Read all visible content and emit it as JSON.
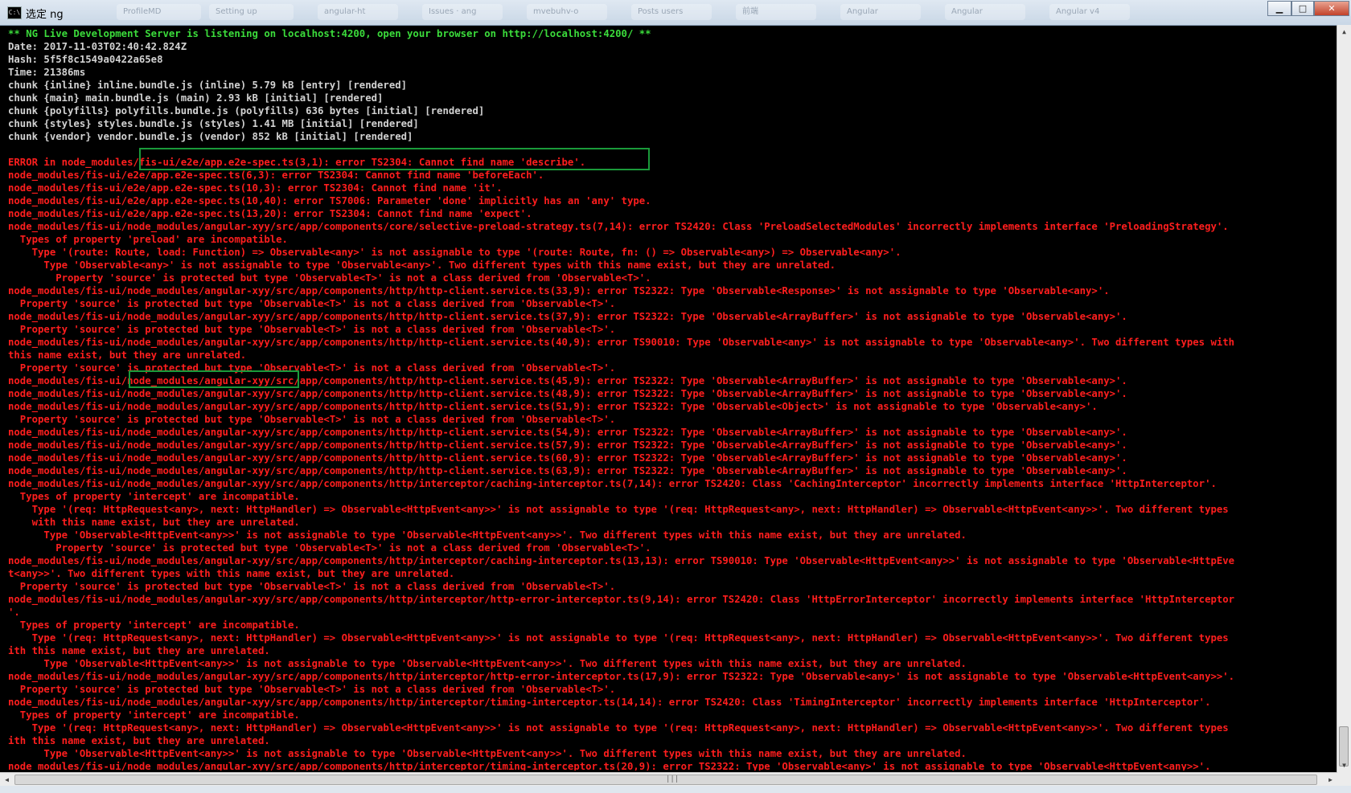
{
  "window": {
    "title": "选定 ng",
    "icon": "console-icon",
    "taskbar_ghost_tabs": [
      "ProfileMD",
      "Setting up",
      "angular-ht",
      "Issues · ang",
      "mvebuhv-o",
      "Posts users",
      "前端",
      "Angular",
      "Angular",
      "Angular v4"
    ],
    "controls": {
      "minimize": "▁",
      "maximize": "□",
      "close": "✕"
    }
  },
  "console": {
    "lines": [
      {
        "color": "green",
        "text": "** NG Live Development Server is listening on localhost:4200, open your browser on http://localhost:4200/ **"
      },
      {
        "color": "white",
        "text": "Date: 2017-11-03T02:40:42.824Z"
      },
      {
        "color": "white",
        "text": "Hash: 5f5f8c1549a0422a65e8"
      },
      {
        "color": "white",
        "text": "Time: 21386ms"
      },
      {
        "color": "white",
        "text": "chunk {inline} inline.bundle.js (inline) 5.79 kB [entry] [rendered]"
      },
      {
        "color": "white",
        "text": "chunk {main} main.bundle.js (main) 2.93 kB [initial] [rendered]"
      },
      {
        "color": "white",
        "text": "chunk {polyfills} polyfills.bundle.js (polyfills) 636 bytes [initial] [rendered]"
      },
      {
        "color": "white",
        "text": "chunk {styles} styles.bundle.js (styles) 1.41 MB [initial] [rendered]"
      },
      {
        "color": "white",
        "text": "chunk {vendor} vendor.bundle.js (vendor) 852 kB [initial] [rendered]"
      },
      {
        "color": "white",
        "text": ""
      },
      {
        "color": "red",
        "text": "ERROR in node_modules/fis-ui/e2e/app.e2e-spec.ts(3,1): error TS2304: Cannot find name 'describe'."
      },
      {
        "color": "red",
        "text": "node_modules/fis-ui/e2e/app.e2e-spec.ts(6,3): error TS2304: Cannot find name 'beforeEach'."
      },
      {
        "color": "red",
        "text": "node_modules/fis-ui/e2e/app.e2e-spec.ts(10,3): error TS2304: Cannot find name 'it'."
      },
      {
        "color": "red",
        "text": "node_modules/fis-ui/e2e/app.e2e-spec.ts(10,40): error TS7006: Parameter 'done' implicitly has an 'any' type."
      },
      {
        "color": "red",
        "text": "node_modules/fis-ui/e2e/app.e2e-spec.ts(13,20): error TS2304: Cannot find name 'expect'."
      },
      {
        "color": "red",
        "text": "node_modules/fis-ui/node_modules/angular-xyy/src/app/components/core/selective-preload-strategy.ts(7,14): error TS2420: Class 'PreloadSelectedModules' incorrectly implements interface 'PreloadingStrategy'."
      },
      {
        "color": "red",
        "text": "  Types of property 'preload' are incompatible."
      },
      {
        "color": "red",
        "text": "    Type '(route: Route, load: Function) => Observable<any>' is not assignable to type '(route: Route, fn: () => Observable<any>) => Observable<any>'."
      },
      {
        "color": "red",
        "text": "      Type 'Observable<any>' is not assignable to type 'Observable<any>'. Two different types with this name exist, but they are unrelated."
      },
      {
        "color": "red",
        "text": "        Property 'source' is protected but type 'Observable<T>' is not a class derived from 'Observable<T>'."
      },
      {
        "color": "red",
        "text": "node_modules/fis-ui/node_modules/angular-xyy/src/app/components/http/http-client.service.ts(33,9): error TS2322: Type 'Observable<Response>' is not assignable to type 'Observable<any>'."
      },
      {
        "color": "red",
        "text": "  Property 'source' is protected but type 'Observable<T>' is not a class derived from 'Observable<T>'."
      },
      {
        "color": "red",
        "text": "node_modules/fis-ui/node_modules/angular-xyy/src/app/components/http/http-client.service.ts(37,9): error TS2322: Type 'Observable<ArrayBuffer>' is not assignable to type 'Observable<any>'."
      },
      {
        "color": "red",
        "text": "  Property 'source' is protected but type 'Observable<T>' is not a class derived from 'Observable<T>'."
      },
      {
        "color": "red",
        "text": "node_modules/fis-ui/node_modules/angular-xyy/src/app/components/http/http-client.service.ts(40,9): error TS90010: Type 'Observable<any>' is not assignable to type 'Observable<any>'. Two different types with"
      },
      {
        "color": "red",
        "text": "this name exist, but they are unrelated."
      },
      {
        "color": "red",
        "text": "  Property 'source' is protected but type 'Observable<T>' is not a class derived from 'Observable<T>'."
      },
      {
        "color": "red",
        "text": "node_modules/fis-ui/node_modules/angular-xyy/src/app/components/http/http-client.service.ts(45,9): error TS2322: Type 'Observable<ArrayBuffer>' is not assignable to type 'Observable<any>'."
      },
      {
        "color": "red",
        "text": "node_modules/fis-ui/node_modules/angular-xyy/src/app/components/http/http-client.service.ts(48,9): error TS2322: Type 'Observable<ArrayBuffer>' is not assignable to type 'Observable<any>'."
      },
      {
        "color": "red",
        "text": "node_modules/fis-ui/node_modules/angular-xyy/src/app/components/http/http-client.service.ts(51,9): error TS2322: Type 'Observable<Object>' is not assignable to type 'Observable<any>'."
      },
      {
        "color": "red",
        "text": "  Property 'source' is protected but type 'Observable<T>' is not a class derived from 'Observable<T>'."
      },
      {
        "color": "red",
        "text": "node_modules/fis-ui/node_modules/angular-xyy/src/app/components/http/http-client.service.ts(54,9): error TS2322: Type 'Observable<ArrayBuffer>' is not assignable to type 'Observable<any>'."
      },
      {
        "color": "red",
        "text": "node_modules/fis-ui/node_modules/angular-xyy/src/app/components/http/http-client.service.ts(57,9): error TS2322: Type 'Observable<ArrayBuffer>' is not assignable to type 'Observable<any>'."
      },
      {
        "color": "red",
        "text": "node_modules/fis-ui/node_modules/angular-xyy/src/app/components/http/http-client.service.ts(60,9): error TS2322: Type 'Observable<ArrayBuffer>' is not assignable to type 'Observable<any>'."
      },
      {
        "color": "red",
        "text": "node_modules/fis-ui/node_modules/angular-xyy/src/app/components/http/http-client.service.ts(63,9): error TS2322: Type 'Observable<ArrayBuffer>' is not assignable to type 'Observable<any>'."
      },
      {
        "color": "red",
        "text": "node_modules/fis-ui/node_modules/angular-xyy/src/app/components/http/interceptor/caching-interceptor.ts(7,14): error TS2420: Class 'CachingInterceptor' incorrectly implements interface 'HttpInterceptor'."
      },
      {
        "color": "red",
        "text": "  Types of property 'intercept' are incompatible."
      },
      {
        "color": "red",
        "text": "    Type '(req: HttpRequest<any>, next: HttpHandler) => Observable<HttpEvent<any>>' is not assignable to type '(req: HttpRequest<any>, next: HttpHandler) => Observable<HttpEvent<any>>'. Two different types"
      },
      {
        "color": "red",
        "text": "    with this name exist, but they are unrelated."
      },
      {
        "color": "red",
        "text": "      Type 'Observable<HttpEvent<any>>' is not assignable to type 'Observable<HttpEvent<any>>'. Two different types with this name exist, but they are unrelated."
      },
      {
        "color": "red",
        "text": "        Property 'source' is protected but type 'Observable<T>' is not a class derived from 'Observable<T>'."
      },
      {
        "color": "red",
        "text": "node_modules/fis-ui/node_modules/angular-xyy/src/app/components/http/interceptor/caching-interceptor.ts(13,13): error TS90010: Type 'Observable<HttpEvent<any>>' is not assignable to type 'Observable<HttpEve"
      },
      {
        "color": "red",
        "text": "t<any>>'. Two different types with this name exist, but they are unrelated."
      },
      {
        "color": "red",
        "text": "  Property 'source' is protected but type 'Observable<T>' is not a class derived from 'Observable<T>'."
      },
      {
        "color": "red",
        "text": "node_modules/fis-ui/node_modules/angular-xyy/src/app/components/http/interceptor/http-error-interceptor.ts(9,14): error TS2420: Class 'HttpErrorInterceptor' incorrectly implements interface 'HttpInterceptor"
      },
      {
        "color": "red",
        "text": "'."
      },
      {
        "color": "red",
        "text": "  Types of property 'intercept' are incompatible."
      },
      {
        "color": "red",
        "text": "    Type '(req: HttpRequest<any>, next: HttpHandler) => Observable<HttpEvent<any>>' is not assignable to type '(req: HttpRequest<any>, next: HttpHandler) => Observable<HttpEvent<any>>'. Two different types"
      },
      {
        "color": "red",
        "text": "ith this name exist, but they are unrelated."
      },
      {
        "color": "red",
        "text": "      Type 'Observable<HttpEvent<any>>' is not assignable to type 'Observable<HttpEvent<any>>'. Two different types with this name exist, but they are unrelated."
      },
      {
        "color": "red",
        "text": "node_modules/fis-ui/node_modules/angular-xyy/src/app/components/http/interceptor/http-error-interceptor.ts(17,9): error TS2322: Type 'Observable<any>' is not assignable to type 'Observable<HttpEvent<any>>'."
      },
      {
        "color": "red",
        "text": "  Property 'source' is protected but type 'Observable<T>' is not a class derived from 'Observable<T>'."
      },
      {
        "color": "red",
        "text": "node_modules/fis-ui/node_modules/angular-xyy/src/app/components/http/interceptor/timing-interceptor.ts(14,14): error TS2420: Class 'TimingInterceptor' incorrectly implements interface 'HttpInterceptor'."
      },
      {
        "color": "red",
        "text": "  Types of property 'intercept' are incompatible."
      },
      {
        "color": "red",
        "text": "    Type '(req: HttpRequest<any>, next: HttpHandler) => Observable<HttpEvent<any>>' is not assignable to type '(req: HttpRequest<any>, next: HttpHandler) => Observable<HttpEvent<any>>'. Two different types"
      },
      {
        "color": "red",
        "text": "ith this name exist, but they are unrelated."
      },
      {
        "color": "red",
        "text": "      Type 'Observable<HttpEvent<any>>' is not assignable to type 'Observable<HttpEvent<any>>'. Two different types with this name exist, but they are unrelated."
      },
      {
        "color": "red",
        "text": "node_modules/fis-ui/node_modules/angular-xyy/src/app/components/http/interceptor/timing-interceptor.ts(20,9): error TS2322: Type 'Observable<any>' is not assignable to type 'Observable<HttpEvent<any>>'."
      }
    ]
  },
  "colors": {
    "green": "#3bdb3b",
    "white": "#d2d2d2",
    "yellow": "#e6e63c",
    "red": "#ff1e1e",
    "highlight_box": "#1a9a3a",
    "background": "#000000"
  },
  "highlights": [
    "describe-error-highlight",
    "angular-xyy-path-highlight"
  ]
}
